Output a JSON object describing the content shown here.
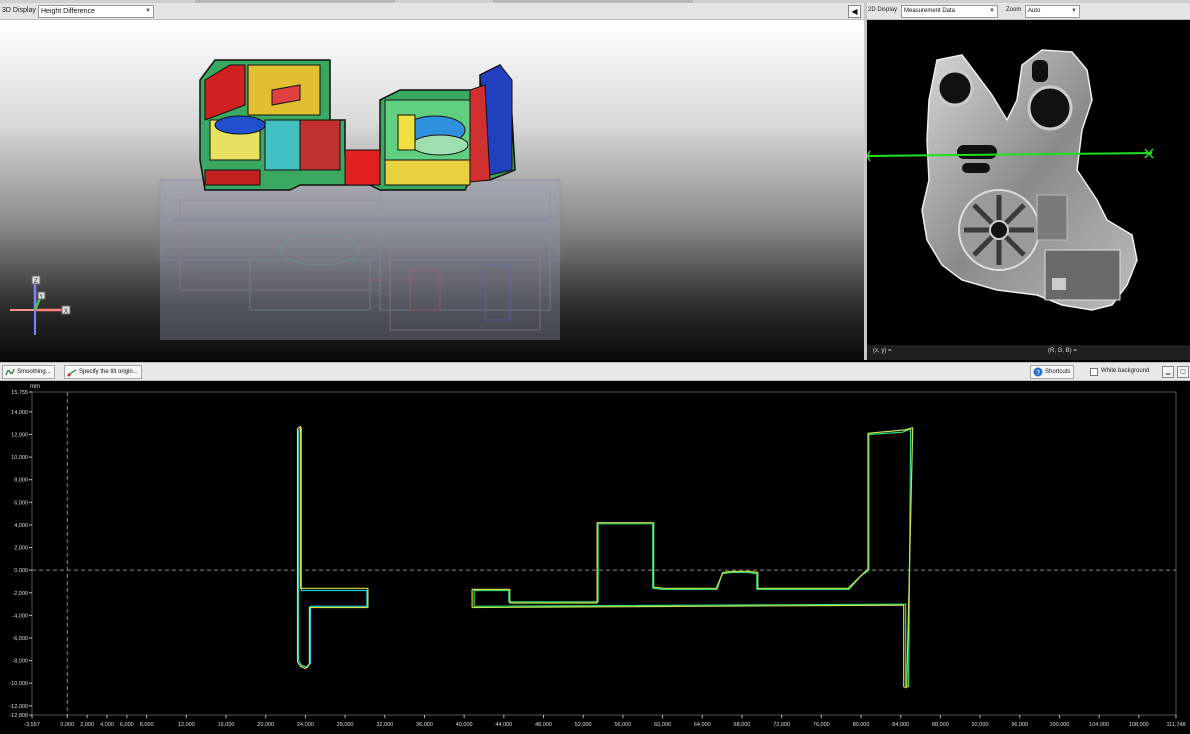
{
  "display3d": {
    "label": "3D Display",
    "mode_value": "Height Difference",
    "collapse_glyph": "◀",
    "axes": {
      "z": "Z",
      "x": "X",
      "y": "Y"
    }
  },
  "display2d": {
    "label": "2D Display",
    "data_value": "Measurement Data",
    "zoom_label": "Zoom",
    "zoom_value": "Auto",
    "coord_xy": "(x, y)  =",
    "coord_rgb": "(R, G, B)  ="
  },
  "profile_toolbar": {
    "smoothing_label": "Smoothing...",
    "tilt_label": "Specify the tilt origin...",
    "shortcuts_label": "Shortcuts",
    "white_bg_label": "White background"
  },
  "profile_chart": {
    "unit": "mm",
    "y_tick_labels": [
      "15,755",
      "14,000",
      "12,000",
      "10,000",
      "8,000",
      "6,000",
      "4,000",
      "2,000",
      "0,000",
      "-2,000",
      "-4,000",
      "-6,000",
      "-8,000",
      "-10,000",
      "-12,000",
      "-12,808"
    ],
    "x_tick_labels": [
      "-3,557",
      "0,000",
      "2,000",
      "4,000",
      "6,000",
      "8,000",
      "12,000",
      "16,000",
      "20,000",
      "24,000",
      "28,000",
      "32,000",
      "36,000",
      "40,000",
      "44,000",
      "48,000",
      "52,000",
      "56,000",
      "60,000",
      "64,000",
      "68,000",
      "72,000",
      "76,000",
      "80,000",
      "84,000",
      "88,000",
      "92,000",
      "96,000",
      "100,000",
      "104,000",
      "108,000",
      "111,748"
    ]
  },
  "chart_data": {
    "type": "line",
    "xlabel": "",
    "ylabel": "mm",
    "xlim": [
      -3.557,
      111.748
    ],
    "ylim": [
      -12.808,
      15.755
    ],
    "series": [
      {
        "color": "#1fd3e0",
        "x": [
          23.3,
          23.3,
          23.6,
          23.6,
          23.9,
          24.3,
          24.3,
          30.2,
          30.2,
          24.5,
          24.5,
          24.2,
          23.6,
          23.3,
          23.3
        ],
        "y": [
          -8.0,
          12.3,
          12.6,
          -1.8,
          -1.8,
          -1.8,
          -1.8,
          -1.8,
          -3.2,
          -3.2,
          -8.2,
          -8.6,
          -8.4,
          -8.0,
          -8.0
        ]
      },
      {
        "color": "#2be07a",
        "x": [
          41.0,
          41.0,
          44.5,
          44.5,
          53.5,
          53.5,
          59.0,
          59.0,
          60.0,
          65.5,
          66.0,
          67.0,
          68.5,
          69.5,
          69.5,
          78.8,
          80.0,
          80.8,
          80.8,
          84.2,
          85.0,
          85.0,
          84.8,
          84.5,
          84.5,
          41.0
        ],
        "y": [
          -3.2,
          -1.8,
          -1.8,
          -2.8,
          -2.8,
          4.1,
          4.1,
          -1.6,
          -1.7,
          -1.7,
          -0.3,
          -0.2,
          -0.2,
          -0.3,
          -1.7,
          -1.7,
          -0.5,
          0.0,
          12.0,
          12.2,
          12.5,
          12.0,
          -10.3,
          -10.2,
          -3.0,
          -3.2
        ]
      },
      {
        "color": "#d8e03a",
        "x": [
          23.2,
          23.2,
          23.5,
          23.5,
          24.1,
          30.3,
          30.3,
          24.4,
          24.4,
          24.0,
          23.5,
          23.2
        ],
        "y": [
          -8.1,
          12.5,
          12.7,
          -1.6,
          -1.6,
          -1.6,
          -3.3,
          -3.3,
          -8.3,
          -8.7,
          -8.5,
          -8.1
        ]
      },
      {
        "color": "#c9e048",
        "x": [
          40.8,
          40.8,
          44.6,
          44.6,
          53.4,
          53.4,
          59.1,
          59.1,
          60.2,
          65.4,
          66.1,
          67.1,
          68.6,
          69.6,
          69.6,
          78.7,
          80.1,
          80.7,
          80.7,
          84.4,
          85.2,
          85.2,
          84.6,
          84.3,
          84.3,
          40.8
        ],
        "y": [
          -3.3,
          -1.7,
          -1.7,
          -2.9,
          -2.9,
          4.2,
          4.2,
          -1.5,
          -1.6,
          -1.6,
          -0.2,
          -0.1,
          -0.1,
          -0.2,
          -1.6,
          -1.6,
          -0.4,
          0.1,
          12.1,
          12.4,
          12.6,
          12.1,
          -10.4,
          -10.3,
          -3.1,
          -3.3
        ]
      }
    ],
    "annotations": [],
    "grid": false,
    "reference_lines": {
      "x": 0,
      "y": 0,
      "style": "dashed"
    }
  }
}
